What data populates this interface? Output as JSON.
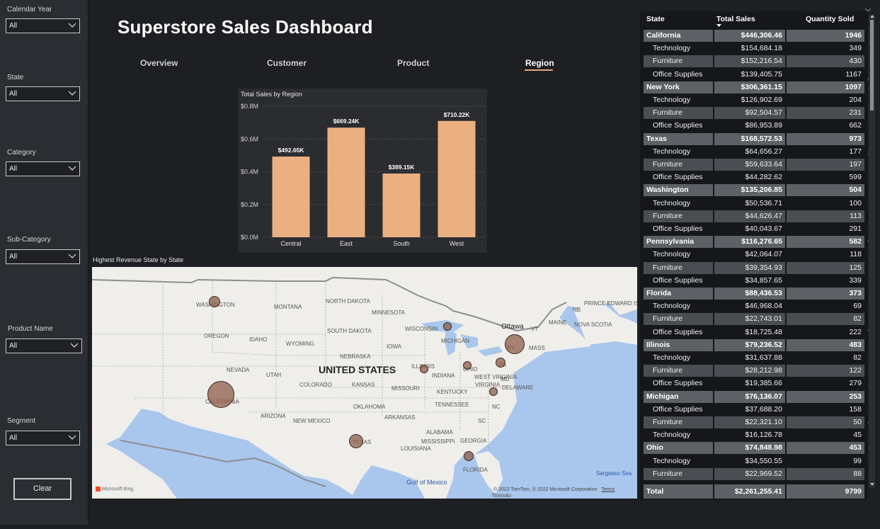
{
  "slicers": [
    {
      "label": "Calendar Year",
      "value": "All"
    },
    {
      "label": "State",
      "value": "All"
    },
    {
      "label": "Category",
      "value": "All"
    },
    {
      "label": "Sub-Category",
      "value": "All"
    },
    {
      "label": "Product Name",
      "value": "All"
    },
    {
      "label": "Segment",
      "value": "All"
    }
  ],
  "clear_label": "Clear",
  "title": "Superstore Sales Dashboard",
  "tabs": [
    {
      "label": "Overview",
      "active": false
    },
    {
      "label": "Customer",
      "active": false
    },
    {
      "label": "Product",
      "active": false
    },
    {
      "label": "Region",
      "active": true
    }
  ],
  "accent_color": "#e9a77a",
  "chart_data": {
    "type": "bar",
    "title": "Total Sales by Region",
    "categories": [
      "Central",
      "East",
      "South",
      "West"
    ],
    "values": [
      492650,
      669240,
      389150,
      710220
    ],
    "data_labels": [
      "$492.65K",
      "$669.24K",
      "$389.15K",
      "$710.22K"
    ],
    "y_ticks": [
      "$0.0M",
      "$0.2M",
      "$0.4M",
      "$0.6M",
      "$0.8M"
    ],
    "ylim": [
      0,
      800000
    ],
    "bar_color": "#ebb081",
    "grid": true
  },
  "map": {
    "title": "Highest Revenue State by State",
    "country_label": "UNITED STATES",
    "state_labels": [
      "WASHINGTON",
      "MONTANA",
      "NORTH DAKOTA",
      "MINNESOTA",
      "OREGON",
      "IDAHO",
      "WYOMING",
      "SOUTH DAKOTA",
      "WISCONSIN",
      "MICHIGAN",
      "NEBRASKA",
      "IOWA",
      "NEVADA",
      "UTAH",
      "ILLINOIS",
      "INDIANA",
      "OHIO",
      "COLORADO",
      "KANSAS",
      "MISSOURI",
      "WEST VIRGINIA",
      "KENTUCKY",
      "VIRGINIA",
      "CALIFORNIA",
      "OKLAHOMA",
      "TENNESSEE",
      "NC",
      "ARIZONA",
      "NEW MEXICO",
      "ARKANSAS",
      "SC",
      "ALABAMA",
      "MISSISSIPPI",
      "GEORGIA",
      "TEXAS",
      "LOUISIANA",
      "FLORIDA",
      "NB",
      "PRINCE EDWARD ISLAND",
      "NOVA SCOTIA",
      "MAINE",
      "VT",
      "MASS",
      "NY",
      "PA",
      "MD",
      "DELAWARE",
      "Ottawa",
      "Gulf of Mexico",
      "Sargasso Sea",
      "Nassau"
    ],
    "attribution": "© 2022 TomTom, © 2022 Microsoft Corporation",
    "terms": "Terms",
    "logo": "Microsoft Bing"
  },
  "table": {
    "headers": [
      "State",
      "Total Sales",
      "Quantity Sold"
    ],
    "groups": [
      {
        "state": "California",
        "sales": "$446,306.46",
        "qty": "1946",
        "items": [
          [
            "Technology",
            "$154,684.18",
            "349"
          ],
          [
            "Furniture",
            "$152,216.54",
            "430"
          ],
          [
            "Office Supplies",
            "$139,405.75",
            "1167"
          ]
        ]
      },
      {
        "state": "New York",
        "sales": "$306,361.15",
        "qty": "1097",
        "items": [
          [
            "Technology",
            "$126,902.69",
            "204"
          ],
          [
            "Furniture",
            "$92,504.57",
            "231"
          ],
          [
            "Office Supplies",
            "$86,953.89",
            "662"
          ]
        ]
      },
      {
        "state": "Texas",
        "sales": "$168,572.53",
        "qty": "973",
        "items": [
          [
            "Technology",
            "$64,656.27",
            "177"
          ],
          [
            "Furniture",
            "$59,633.64",
            "197"
          ],
          [
            "Office Supplies",
            "$44,282.62",
            "599"
          ]
        ]
      },
      {
        "state": "Washington",
        "sales": "$135,206.85",
        "qty": "504",
        "items": [
          [
            "Technology",
            "$50,536.71",
            "100"
          ],
          [
            "Furniture",
            "$44,626.47",
            "113"
          ],
          [
            "Office Supplies",
            "$40,043.67",
            "291"
          ]
        ]
      },
      {
        "state": "Pennsylvania",
        "sales": "$116,276.65",
        "qty": "582",
        "items": [
          [
            "Technology",
            "$42,064.07",
            "118"
          ],
          [
            "Furniture",
            "$39,354.93",
            "125"
          ],
          [
            "Office Supplies",
            "$34,857.65",
            "339"
          ]
        ]
      },
      {
        "state": "Florida",
        "sales": "$88,436.53",
        "qty": "373",
        "items": [
          [
            "Technology",
            "$46,968.04",
            "69"
          ],
          [
            "Furniture",
            "$22,743.01",
            "82"
          ],
          [
            "Office Supplies",
            "$18,725.48",
            "222"
          ]
        ]
      },
      {
        "state": "Illinois",
        "sales": "$79,236.52",
        "qty": "483",
        "items": [
          [
            "Technology",
            "$31,637.88",
            "82"
          ],
          [
            "Furniture",
            "$28,212.98",
            "122"
          ],
          [
            "Office Supplies",
            "$19,385.66",
            "279"
          ]
        ]
      },
      {
        "state": "Michigan",
        "sales": "$76,136.07",
        "qty": "253",
        "items": [
          [
            "Office Supplies",
            "$37,688.20",
            "158"
          ],
          [
            "Furniture",
            "$22,321.10",
            "50"
          ],
          [
            "Technology",
            "$16,126.78",
            "45"
          ]
        ]
      },
      {
        "state": "Ohio",
        "sales": "$74,848.98",
        "qty": "453",
        "items": [
          [
            "Technology",
            "$34,550.55",
            "99"
          ],
          [
            "Furniture",
            "$22,969.52",
            "88"
          ]
        ]
      }
    ],
    "total": {
      "label": "Total",
      "sales": "$2,261,255.41",
      "qty": "9799"
    }
  }
}
